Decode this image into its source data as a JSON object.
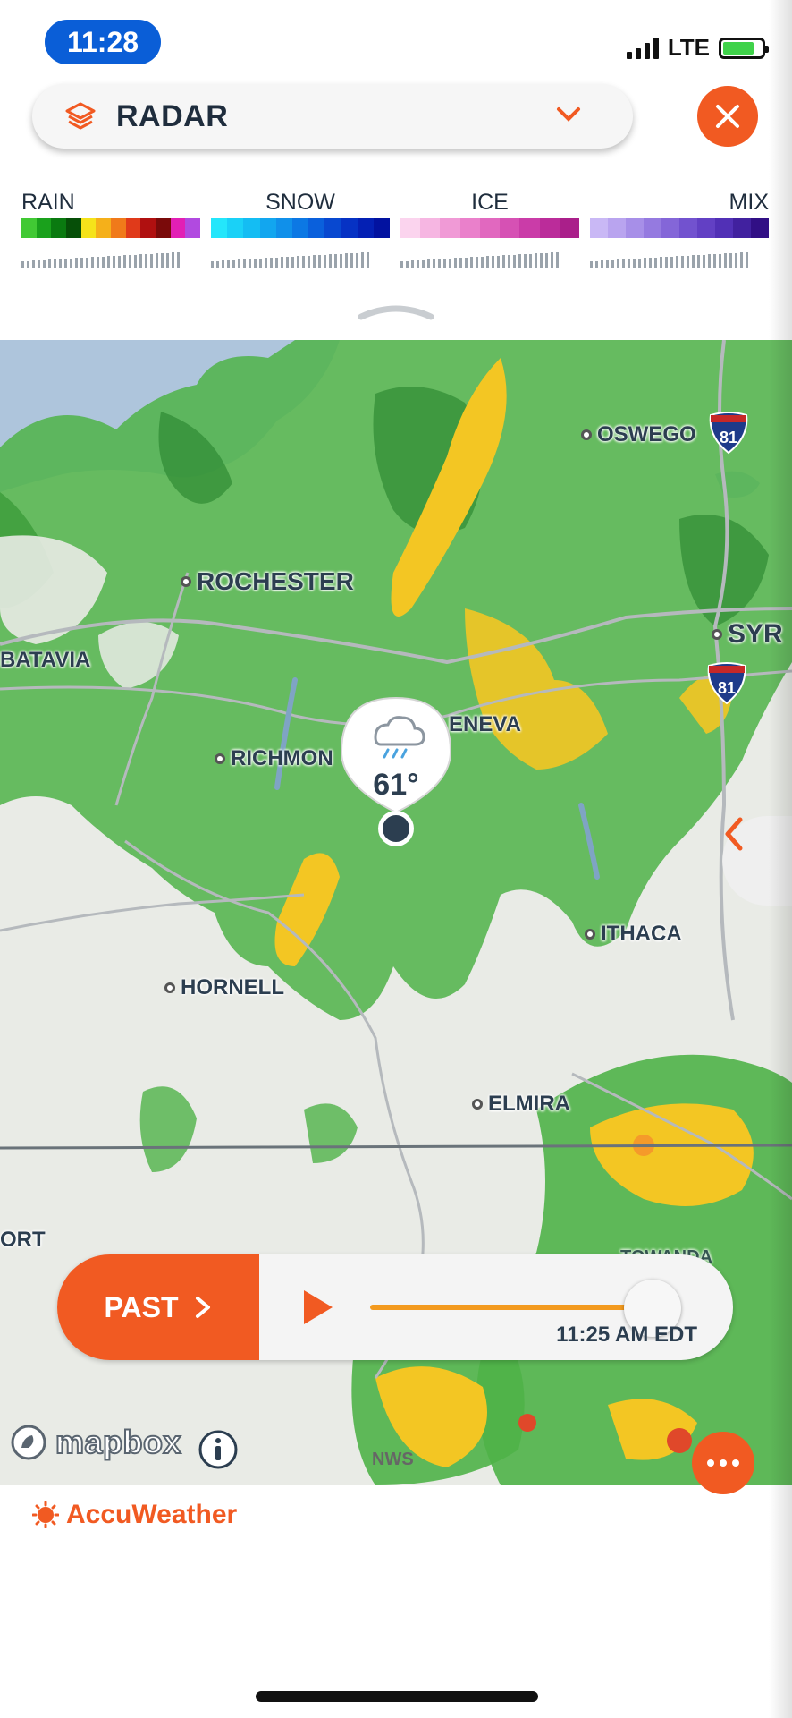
{
  "status_bar": {
    "time": "11:28",
    "network": "LTE"
  },
  "header": {
    "title": "RADAR",
    "layers_icon": "layers-icon",
    "dropdown_icon": "chevron-down-icon",
    "close_icon": "close-icon"
  },
  "legend": {
    "groups": [
      {
        "label": "RAIN",
        "colors": [
          "#41c934",
          "#1aa11c",
          "#0a7a10",
          "#064f08",
          "#f5e31a",
          "#f5b01a",
          "#f07a1a",
          "#e03a1a",
          "#b01010",
          "#7a0a0a",
          "#e21fb5",
          "#b14ae0"
        ]
      },
      {
        "label": "SNOW",
        "colors": [
          "#24e6fb",
          "#1ad1f7",
          "#14bdf3",
          "#12a6ef",
          "#1090ea",
          "#0c78e4",
          "#0a60dc",
          "#0848d0",
          "#0632c4",
          "#0420b4",
          "#0212a0"
        ]
      },
      {
        "label": "ICE",
        "colors": [
          "#fbd4ee",
          "#f6b6e2",
          "#f09ad6",
          "#ea80cb",
          "#e168bf",
          "#d651b4",
          "#ca3ca8",
          "#bb2c9a",
          "#aa1f8a"
        ]
      },
      {
        "label": "MIX",
        "colors": [
          "#c9b8f5",
          "#b9a4ef",
          "#a78fe8",
          "#957ae0",
          "#8466d8",
          "#7252cf",
          "#6240c4",
          "#5130b6",
          "#41219f",
          "#310f85"
        ]
      }
    ]
  },
  "map": {
    "cities": [
      {
        "name": "OSWEGO"
      },
      {
        "name": "ROCHESTER"
      },
      {
        "name": "SYR"
      },
      {
        "name": "BATAVIA"
      },
      {
        "name": "RICHMON"
      },
      {
        "name": "ENEVA"
      },
      {
        "name": "ITHACA"
      },
      {
        "name": "HORNELL"
      },
      {
        "name": "ELMIRA"
      },
      {
        "name": "ORT"
      },
      {
        "name": "TOWANDA"
      }
    ],
    "highway_shields": [
      "81",
      "81"
    ],
    "location_temp": "61°",
    "location_weather_icon": "rain-cloud-icon",
    "attribution": "mapbox",
    "data_source": "NWS",
    "collapse_panel_icon": "chevron-left-icon"
  },
  "timeline": {
    "past_label": "PAST",
    "current_time": "11:25 AM EDT",
    "progress": 0.95
  },
  "footer": {
    "brand": "AccuWeather",
    "more_icon": "more-dots-icon"
  },
  "colors": {
    "accent": "#f15a22",
    "status_blue": "#0a5ed7",
    "radar_green": "#3fa63a",
    "radar_yellow": "#f3c623"
  }
}
